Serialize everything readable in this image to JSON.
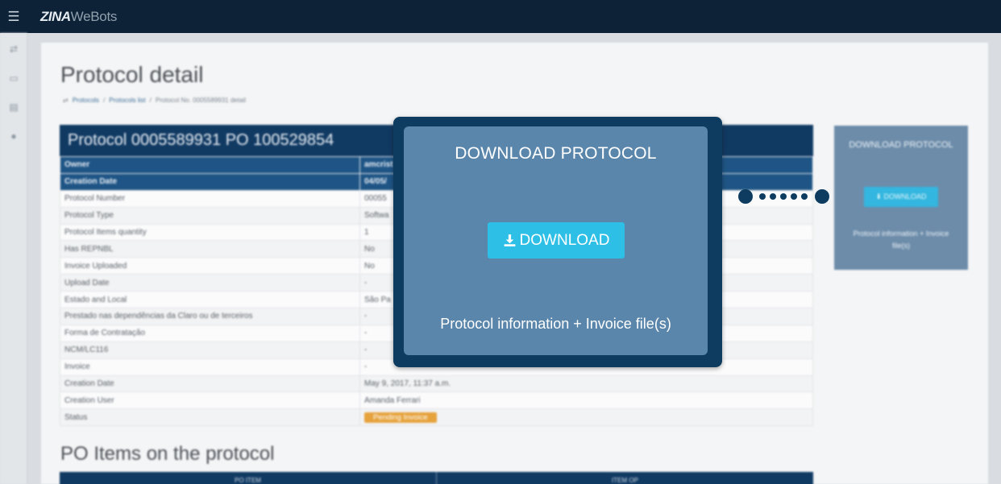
{
  "topbar": {
    "menu_icon": "hamburger-icon",
    "logo_strong": "ZINA",
    "logo_light": "WeBots"
  },
  "rail": {
    "icons": [
      "transfer-icon",
      "money-icon",
      "document-icon",
      "user-icon"
    ]
  },
  "page": {
    "title": "Protocol detail",
    "breadcrumb": [
      "Protocols",
      "Protocols list",
      "Protocol No. 0005589931 detail"
    ]
  },
  "detail": {
    "heading": "Protocol 0005589931 PO 100529854",
    "rows": [
      {
        "label": "Owner",
        "value": "amcrist"
      },
      {
        "label": "Creation Date",
        "value": "04/05/"
      },
      {
        "label": "Protocol Number",
        "value": "00055"
      },
      {
        "label": "Protocol Type",
        "value": "Softwa"
      },
      {
        "label": "Protocol Items quantity",
        "value": "1"
      },
      {
        "label": "Has REPNBL",
        "value": "No"
      },
      {
        "label": "Invoice Uploaded",
        "value": "No"
      },
      {
        "label": "Upload Date",
        "value": "-"
      },
      {
        "label": "Estado and Local",
        "value": "São Pa"
      },
      {
        "label": "Prestado nas dependências da Claro ou de terceiros",
        "value": "-"
      },
      {
        "label": "Forma de Contratação",
        "value": "-"
      },
      {
        "label": "NCM/LC116",
        "value": "-"
      },
      {
        "label": "Invoice",
        "value": "-"
      },
      {
        "label": "Creation Date",
        "value": "May 9, 2017, 11:37 a.m."
      },
      {
        "label": "Creation User",
        "value": "Amanda Ferrari"
      },
      {
        "label": "Status",
        "value": "Pending Invoice"
      }
    ]
  },
  "po": {
    "title": "PO Items on the protocol",
    "columns": [
      "PO ITEM",
      "ITEM OP"
    ]
  },
  "side_card": {
    "title": "DOWNLOAD PROTOCOL",
    "button": "DOWNLOAD",
    "description": "Protocol information + Invoice file(s)"
  },
  "popup": {
    "title": "DOWNLOAD PROTOCOL",
    "button": "DOWNLOAD",
    "description": "Protocol information + Invoice file(s)"
  },
  "colors": {
    "topbar": "#0d2236",
    "popup_border": "#0d3c60",
    "popup_body": "#5b86ab",
    "button": "#2ebfe6",
    "status_badge": "#e6a23c"
  }
}
